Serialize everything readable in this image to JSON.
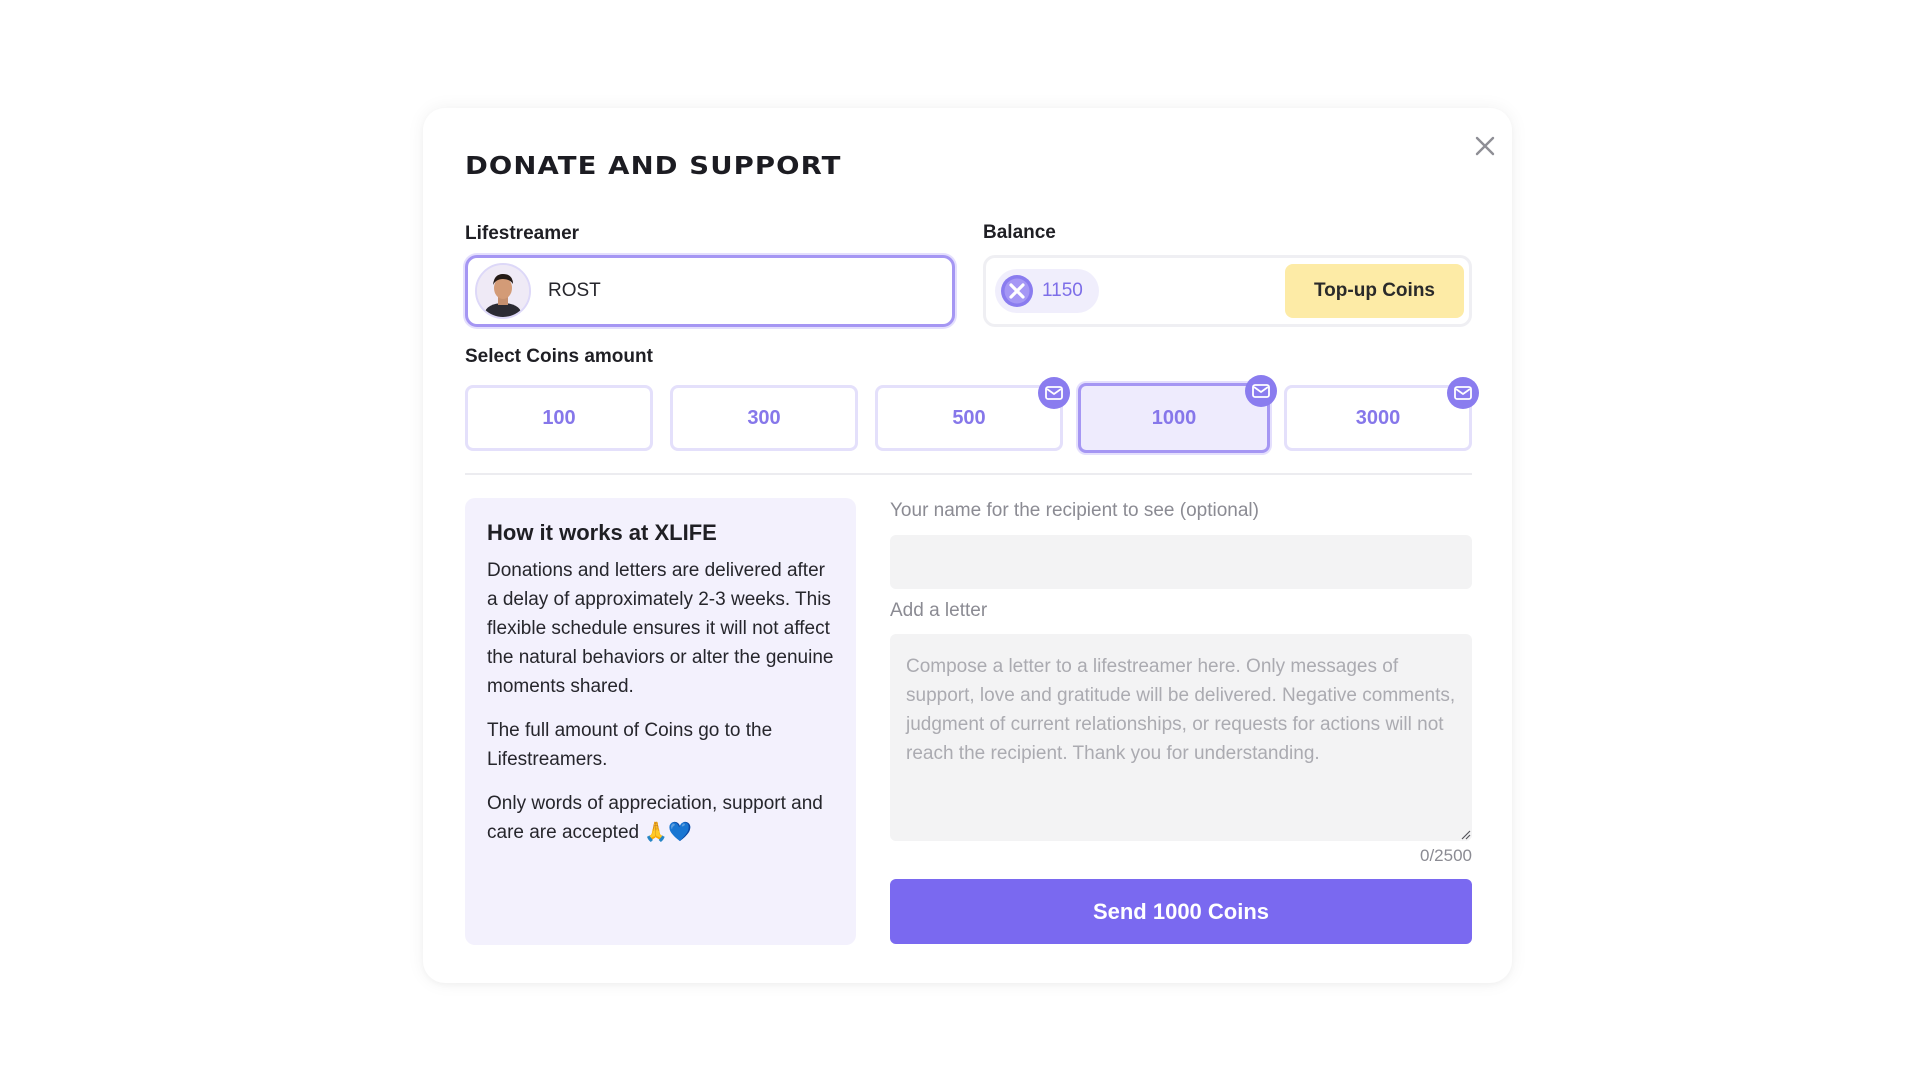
{
  "modal": {
    "title": "DONATE AND SUPPORT",
    "close_icon": "close-icon"
  },
  "lifestreamer": {
    "label": "Lifestreamer",
    "name": "ROST",
    "avatar_icon": "avatar"
  },
  "balance": {
    "label": "Balance",
    "coins": "1150",
    "coin_icon": "coin-icon",
    "topup_label": "Top-up Coins"
  },
  "coins_amount": {
    "label": "Select Coins amount",
    "options": [
      {
        "value": "100",
        "letter_badge": false,
        "selected": false
      },
      {
        "value": "300",
        "letter_badge": false,
        "selected": false
      },
      {
        "value": "500",
        "letter_badge": true,
        "selected": false
      },
      {
        "value": "1000",
        "letter_badge": true,
        "selected": true
      },
      {
        "value": "3000",
        "letter_badge": true,
        "selected": false
      }
    ]
  },
  "info": {
    "title": "How it works at XLIFE",
    "paragraphs": [
      "Donations and letters are delivered after a delay of approximately 2-3 weeks. This flexible schedule ensures it will not affect the natural behaviors or alter the genuine moments shared.",
      "The full amount of Coins go to the Lifestreamers.",
      "Only words of appreciation, support and care are accepted 🙏💙"
    ]
  },
  "form": {
    "name_label": "Your name for the recipient to see (optional)",
    "name_value": "",
    "letter_label": "Add a letter",
    "letter_placeholder": "Compose a letter to a lifestreamer here. Only messages of support, love and gratitude will be delivered. Negative comments, judgment of current relationships, or requests for actions will not reach the recipient. Thank you for understanding.",
    "counter": "0/2500",
    "send_label": "Send 1000 Coins"
  },
  "colors": {
    "accent": "#7a69f0",
    "accent_light": "#eeebfd",
    "topup": "#fdeba6",
    "info_bg": "#f3f1fd"
  }
}
